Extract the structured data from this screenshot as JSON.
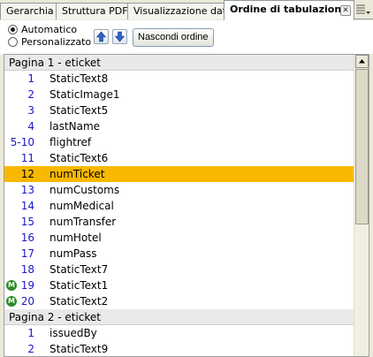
{
  "tabs": [
    {
      "label": "Gerarchia",
      "active": false
    },
    {
      "label": "Struttura PDF",
      "active": false
    },
    {
      "label": "Visualizzazione dati",
      "active": false
    },
    {
      "label": "Ordine di tabulazione",
      "active": true
    }
  ],
  "tab_close_icon": "close-icon",
  "tab_menu_icon": "panel-menu-icon",
  "toolbar": {
    "radio_automatic": "Automatico",
    "radio_custom": "Personalizzato",
    "selected_mode": "Automatico",
    "move_up_icon": "arrow-up-icon",
    "move_down_icon": "arrow-down-icon",
    "hide_order_button": "Nascondi ordine"
  },
  "groups": [
    {
      "header": "Pagina 1 - eticket",
      "rows": [
        {
          "num": "1",
          "name": "StaticText8"
        },
        {
          "num": "2",
          "name": "StaticImage1"
        },
        {
          "num": "3",
          "name": "StaticText5"
        },
        {
          "num": "4",
          "name": "lastName"
        },
        {
          "num": "5-10",
          "name": "flightref"
        },
        {
          "num": "11",
          "name": "StaticText6"
        },
        {
          "num": "12",
          "name": "numTicket",
          "selected": true
        },
        {
          "num": "13",
          "name": "numCustoms"
        },
        {
          "num": "14",
          "name": "numMedical"
        },
        {
          "num": "15",
          "name": "numTransfer"
        },
        {
          "num": "16",
          "name": "numHotel"
        },
        {
          "num": "17",
          "name": "numPass"
        },
        {
          "num": "18",
          "name": "StaticText7"
        },
        {
          "num": "19",
          "name": "StaticText1",
          "master": true
        },
        {
          "num": "20",
          "name": "StaticText2",
          "master": true
        }
      ]
    },
    {
      "header": "Pagina 2 - eticket",
      "rows": [
        {
          "num": "1",
          "name": "issuedBy"
        },
        {
          "num": "2",
          "name": "StaticText9"
        }
      ]
    }
  ],
  "master_badge_letter": "M",
  "colors": {
    "selection": "#f9b800",
    "number": "#1a1ac8",
    "master_badge": "#2b8a2b"
  }
}
